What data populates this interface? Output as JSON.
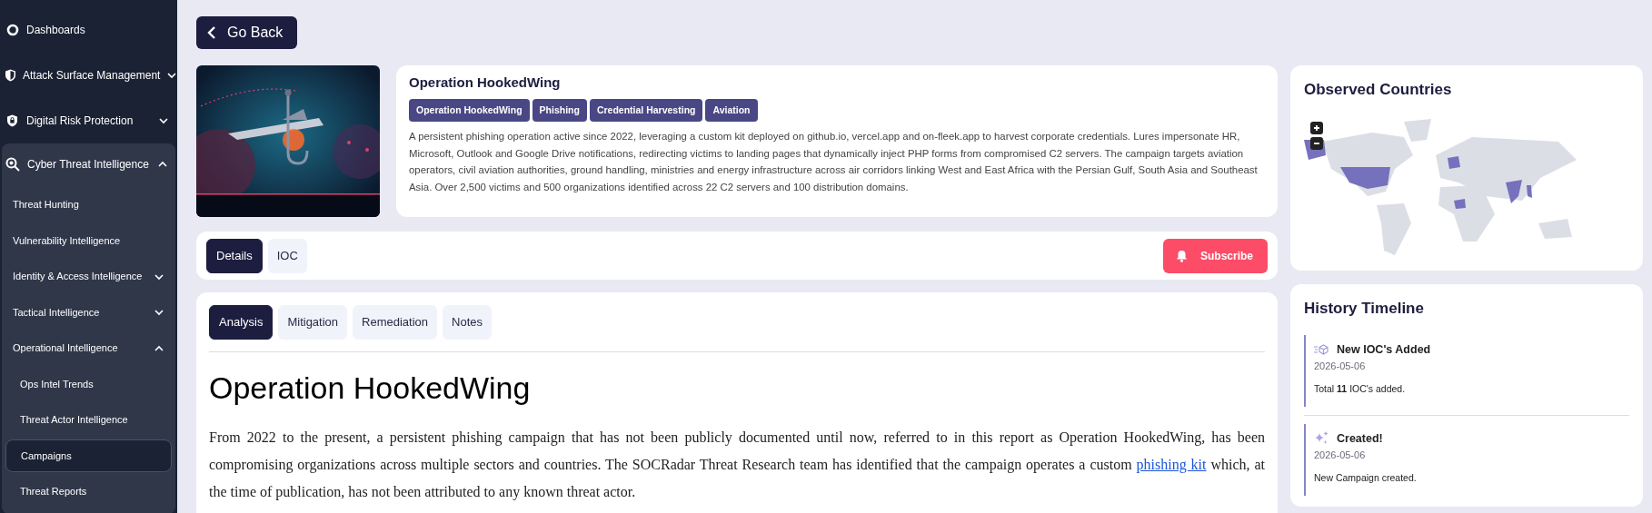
{
  "sidebar": {
    "items": [
      {
        "label": "Dashboards",
        "selected": false
      },
      {
        "label": "Attack Surface Management",
        "expanded": false,
        "selected": false
      },
      {
        "label": "Digital Risk Protection",
        "expanded": false,
        "selected": false
      },
      {
        "label": "Cyber Threat Intelligence",
        "expanded": true,
        "selected": false,
        "children": [
          {
            "label": "Threat Hunting",
            "selected": false
          },
          {
            "label": "Vulnerability Intelligence",
            "selected": false
          },
          {
            "label": "Identity & Access Intelligence",
            "expanded": false,
            "selected": false
          },
          {
            "label": "Tactical Intelligence",
            "expanded": false,
            "selected": false
          },
          {
            "label": "Operational Intelligence",
            "expanded": true,
            "selected": false,
            "children": [
              {
                "label": "Ops Intel Trends",
                "selected": false
              },
              {
                "label": "Threat Actor Intelligence",
                "selected": false
              },
              {
                "label": "Campaigns",
                "selected": true
              },
              {
                "label": "Threat Reports",
                "selected": false
              }
            ]
          }
        ]
      }
    ]
  },
  "back_button": "Go Back",
  "campaign": {
    "image": {
      "kind": "picture"
    },
    "title": "Operation HookedWing",
    "tags": [
      "Operation HookedWing",
      "Phishing",
      "Credential Harvesting",
      "Aviation"
    ],
    "description": "A persistent phishing operation active since 2022, leveraging a custom kit deployed on github.io, vercel.app and on-fleek.app to harvest corporate credentials. Lures impersonate HR, Microsoft, Outlook and Google Drive notifications, redirecting victims to landing pages that dynamically inject PHP forms from compromised C2 servers. The campaign targets aviation operators, civil aviation authorities, ground handling, ministries and energy infrastructure across air corridors linking West and East Africa with the Persian Gulf, South Asia and Southeast Asia. Over 2,500 victims and 500 organizations identified across 22 C2 servers and 100 distribution domains."
  },
  "main_tabs": [
    {
      "label": "Details",
      "selected": true
    },
    {
      "label": "IOC",
      "selected": false
    }
  ],
  "subscribe_button": "Subscribe",
  "content_tabs": [
    {
      "label": "Analysis",
      "selected": true
    },
    {
      "label": "Mitigation",
      "selected": false
    },
    {
      "label": "Remediation",
      "selected": false
    },
    {
      "label": "Notes",
      "selected": false
    }
  ],
  "analysis": {
    "heading": "Operation HookedWing",
    "paragraph": {
      "before": "From 2022 to the present, a persistent phishing campaign that has not been publicly documented until now, referred to in this report as Operation HookedWing, has been compromising organizations across multiple sectors and countries. The SOCRadar Threat Research team has identified that the campaign operates a custom ",
      "link": "phishing kit",
      "after": " which, at the time of publication, has not been attributed to any known threat actor."
    }
  },
  "observed_countries": {
    "title": "Observed Countries"
  },
  "history_timeline": {
    "title": "History Timeline",
    "entries": [
      {
        "kind": "ioc",
        "title": "New IOC's Added",
        "date": "2026-05-06",
        "text": "Total **11** IOC's added."
      },
      {
        "kind": "created",
        "title": "Created!",
        "date": "2026-05-06",
        "text": "New Campaign created."
      }
    ]
  }
}
